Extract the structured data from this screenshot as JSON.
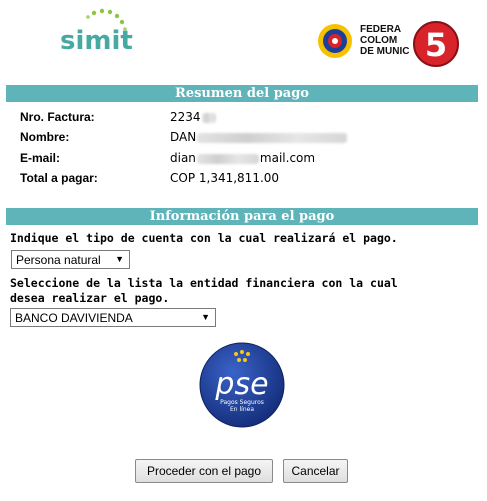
{
  "header": {
    "simit_logo_text": "simit",
    "federacion_logo_text": [
      "FEDERA",
      "COLOM",
      "DE MUNIC"
    ],
    "federacion_logo_number": "5"
  },
  "summary": {
    "title": "Resumen del pago",
    "rows": [
      {
        "label": "Nro. Factura:",
        "value": "2234"
      },
      {
        "label": "Nombre:",
        "value": "DAN"
      },
      {
        "label": "E-mail:",
        "value_prefix": "dian",
        "value_suffix": "mail.com"
      },
      {
        "label": "Total a pagar:",
        "value": "COP 1,341,811.00"
      }
    ]
  },
  "payment": {
    "title": "Información para el pago",
    "account_prompt": "Indique el tipo de cuenta con la cual realizará el pago.",
    "account_type_selected": "Persona natural",
    "bank_prompt_line1": "Seleccione de la lista la entidad financiera con la cual",
    "bank_prompt_line2": "desea realizar el pago.",
    "bank_selected": "BANCO DAVIVIENDA"
  },
  "pse_logo": {
    "word": "pse",
    "tagline_line1": "Pagos Seguros",
    "tagline_line2": "En línea"
  },
  "buttons": {
    "proceed": "Proceder con el pago",
    "cancel": "Cancelar"
  },
  "colors": {
    "band": "#5fb4ba",
    "simit_text": "#46a9a2",
    "pse_blue": "#1a3a8c"
  }
}
